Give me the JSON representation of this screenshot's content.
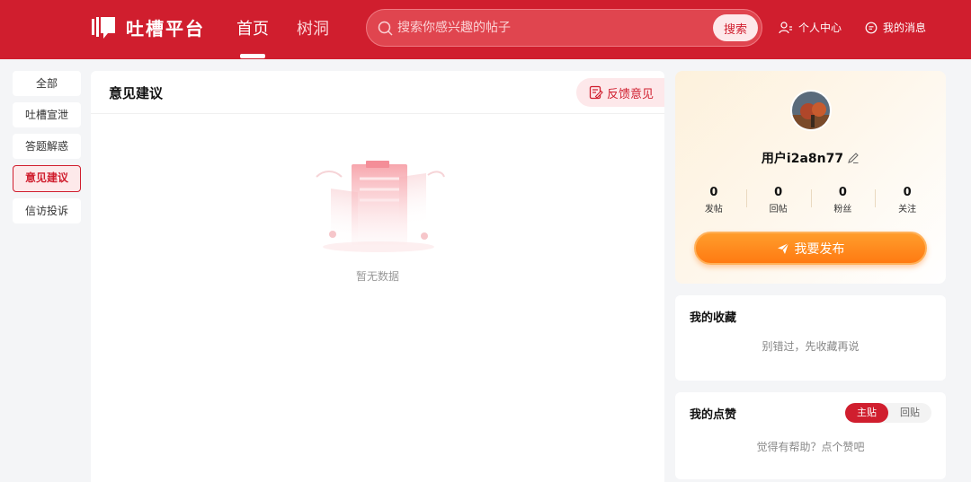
{
  "header": {
    "logo_text": "吐槽平台",
    "nav": [
      {
        "label": "首页"
      },
      {
        "label": "树洞"
      }
    ],
    "search": {
      "placeholder": "搜索你感兴趣的帖子",
      "button_label": "搜索"
    },
    "user_center_label": "个人中心",
    "messages_label": "我的消息"
  },
  "leftnav": {
    "items": [
      {
        "label": "全部"
      },
      {
        "label": "吐槽宣泄"
      },
      {
        "label": "答题解惑"
      },
      {
        "label": "意见建议"
      },
      {
        "label": "信访投诉"
      }
    ],
    "active_index": 3
  },
  "main": {
    "title": "意见建议",
    "feedback_label": "反馈意见",
    "empty_text": "暂无数据"
  },
  "profile": {
    "username": "用户i2a8n77",
    "stats": [
      {
        "value": "0",
        "label": "发帖"
      },
      {
        "value": "0",
        "label": "回帖"
      },
      {
        "value": "0",
        "label": "粉丝"
      },
      {
        "value": "0",
        "label": "关注"
      }
    ],
    "publish_label": "我要发布"
  },
  "favorites": {
    "title": "我的收藏",
    "empty_text": "别错过，先收藏再说"
  },
  "likes": {
    "title": "我的点赞",
    "tabs": [
      {
        "label": "主贴"
      },
      {
        "label": "回贴"
      }
    ],
    "empty_text": "觉得有帮助？点个赞吧"
  },
  "colors": {
    "brand": "#d01e2e",
    "accent": "#ff7a12"
  }
}
